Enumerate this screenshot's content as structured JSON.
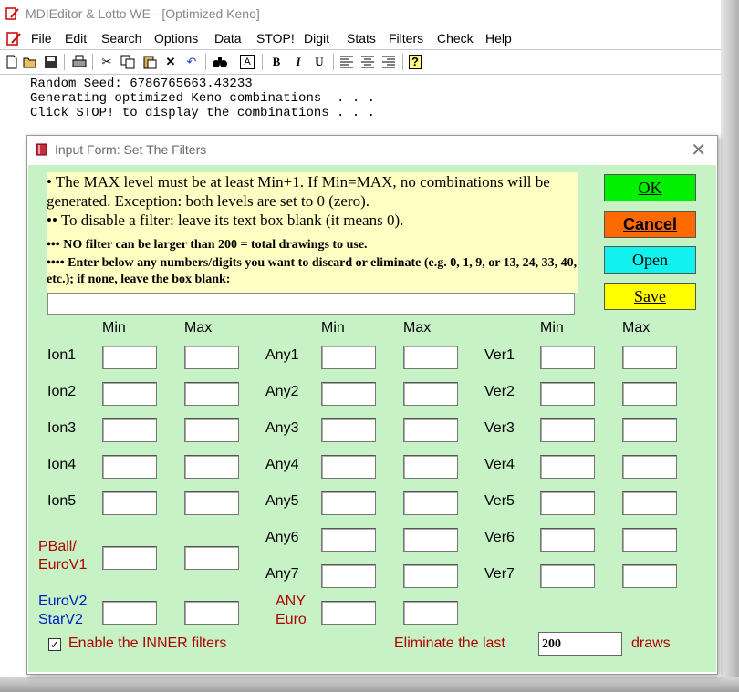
{
  "app": {
    "title": "MDIEditor & Lotto WE - [Optimized Keno]"
  },
  "menu": {
    "items": [
      "File",
      "Edit",
      "Search",
      "Options",
      "Data",
      "STOP!",
      "Digit",
      "Stats",
      "Filters",
      "Check",
      "Help"
    ]
  },
  "toolbar": {
    "icons": [
      "new-file-icon",
      "open-folder-icon",
      "save-disk-icon",
      "print-icon",
      "cut-icon",
      "copy-icon",
      "paste-icon",
      "delete-x-icon",
      "undo-icon",
      "find-binoculars-icon",
      "font-a-icon",
      "bold-icon",
      "italic-icon",
      "underline-icon",
      "align-left-icon",
      "align-center-icon",
      "align-right-icon",
      "help-question-icon"
    ],
    "bold": "B",
    "italic": "I",
    "underline": "U",
    "font": "A",
    "help": "?"
  },
  "editor": {
    "lines": [
      "Random Seed: 6786765663.43233",
      "Generating optimized Keno combinations  . . .",
      "Click STOP! to display the combinations . . ."
    ]
  },
  "dialog": {
    "title": "Input Form: Set The Filters",
    "close": "✕",
    "info": {
      "line1": "• The MAX level must be at least Min+1. If Min=MAX, no combinations will be generated.  Exception: both levels are set to 0 (zero).",
      "line2": "•• To disable a filter: leave its text box blank (it means 0).",
      "line3": "••• NO filter can be larger than 200 = total drawings to use.",
      "line4": "•••• Enter below any numbers/digits you want to discard or eliminate  (e.g.  0, 1, 9, or 13, 24, 33, 40, etc.);  if none, leave the box blank:"
    },
    "eliminate_value": "",
    "buttons": {
      "ok": "OK",
      "cancel": "Cancel",
      "open": "Open",
      "save": "Save"
    },
    "headers": {
      "min": "Min",
      "max": "Max"
    },
    "col1": {
      "labels": [
        "Ion1",
        "Ion2",
        "Ion3",
        "Ion4",
        "Ion5"
      ],
      "pball_line1": "PBall/",
      "pball_line2": "EuroV1",
      "eurov2_line1": "EuroV2",
      "eurov2_line2": "StarV2"
    },
    "col2": {
      "labels": [
        "Any1",
        "Any2",
        "Any3",
        "Any4",
        "Any5",
        "Any6",
        "Any7"
      ],
      "any_euro_line1": "ANY",
      "any_euro_line2": "Euro"
    },
    "col3": {
      "labels": [
        "Ver1",
        "Ver2",
        "Ver3",
        "Ver4",
        "Ver5",
        "Ver6",
        "Ver7"
      ]
    },
    "inner": {
      "checked": true,
      "check_glyph": "✓",
      "label": "Enable the INNER filters"
    },
    "eliminate_last": {
      "label": "Eliminate the last",
      "value": "200",
      "suffix": "draws"
    }
  }
}
